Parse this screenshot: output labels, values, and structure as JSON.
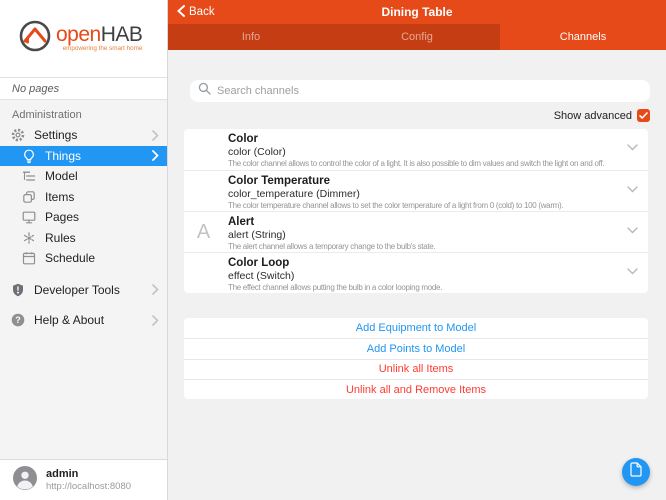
{
  "sidebar": {
    "logo": {
      "brand_open": "open",
      "brand_hab": "HAB",
      "tagline": "empowering the smart home"
    },
    "no_pages": "No pages",
    "section_label": "Administration",
    "items": [
      {
        "label": "Settings"
      },
      {
        "label": "Things"
      },
      {
        "label": "Model"
      },
      {
        "label": "Items"
      },
      {
        "label": "Pages"
      },
      {
        "label": "Rules"
      },
      {
        "label": "Schedule"
      }
    ],
    "bottom_items": [
      {
        "label": "Developer Tools"
      },
      {
        "label": "Help & About"
      }
    ],
    "user": {
      "name": "admin",
      "url": "http://localhost:8080"
    }
  },
  "header": {
    "back_label": "Back",
    "title": "Dining Table",
    "tabs": [
      {
        "label": "Info",
        "active": false
      },
      {
        "label": "Config",
        "active": false
      },
      {
        "label": "Channels",
        "active": true
      }
    ]
  },
  "main": {
    "search_placeholder": "Search channels",
    "show_advanced_label": "Show advanced",
    "show_advanced_checked": true,
    "channels": [
      {
        "title": "Color",
        "subtitle": "color (Color)",
        "description": "The color channel allows to control the color of a light. It is also possible to dim values and switch the light on and off.",
        "icon": "color-wheel-icon"
      },
      {
        "title": "Color Temperature",
        "subtitle": "color_temperature (Dimmer)",
        "description": "The color temperature channel allows to set the color temperature of a light from 0 (cold) to 100 (warm).",
        "icon": "color-wheel-icon"
      },
      {
        "title": "Alert",
        "subtitle": "alert (String)",
        "description": "The alert channel allows a temporary change to the bulb's state.",
        "icon": "letter-a-icon"
      },
      {
        "title": "Color Loop",
        "subtitle": "effect (Switch)",
        "description": "The effect channel allows putting the bulb in a color looping mode.",
        "icon": "color-wheel-icon"
      }
    ],
    "actions": [
      {
        "label": "Add Equipment to Model",
        "color": "blue"
      },
      {
        "label": "Add Points to Model",
        "color": "blue"
      },
      {
        "label": "Unlink all Items",
        "color": "red"
      },
      {
        "label": "Unlink all and Remove Items",
        "color": "red"
      }
    ]
  },
  "colors": {
    "accent_orange": "#e64a19",
    "tabbar_dark": "#c53d12",
    "selected_blue": "#2196f3",
    "link_blue": "#2196f3",
    "danger_red": "#ff3b30"
  }
}
